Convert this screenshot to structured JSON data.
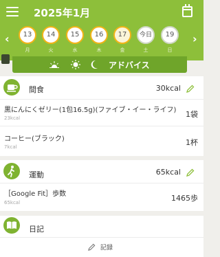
{
  "header": {
    "title": "2025年1月",
    "menu_icon": "hamburger-menu-icon",
    "calendar_icon": "calendar-icon",
    "accent_color": "#8dbf3a",
    "prev_arrow": "‹",
    "next_arrow": "›"
  },
  "week": {
    "days": [
      {
        "num": "13",
        "dow": "月"
      },
      {
        "num": "14",
        "dow": "火"
      },
      {
        "num": "15",
        "dow": "水"
      },
      {
        "num": "16",
        "dow": "木"
      },
      {
        "num": "17",
        "dow": "金"
      },
      {
        "num": "今日",
        "dow": "土"
      },
      {
        "num": "19",
        "dow": "日"
      }
    ],
    "ring_color": "#f2b418",
    "selected": "17"
  },
  "advice": {
    "label": "アドバイス",
    "icons": [
      "sunrise-icon",
      "sun-icon",
      "moon-icon"
    ]
  },
  "snack": {
    "title": "間食",
    "total": "30kcal",
    "icon": "coffee-cup-icon",
    "items": [
      {
        "name": "黒にんにくゼリー(1包16.5g)(ファイブ・イー・ライフ)",
        "kcal": "23kcal",
        "qty": "1袋"
      },
      {
        "name": "コーヒー(ブラック)",
        "kcal": "7kcal",
        "qty": "1杯"
      }
    ]
  },
  "exercise": {
    "title": "運動",
    "total": "65kcal",
    "icon": "exercise-person-icon",
    "items": [
      {
        "name": "［Google Fit］歩数",
        "kcal": "65kcal",
        "qty": "1465歩"
      }
    ]
  },
  "diary": {
    "title": "日記",
    "icon": "book-icon",
    "record_label": "記録"
  }
}
